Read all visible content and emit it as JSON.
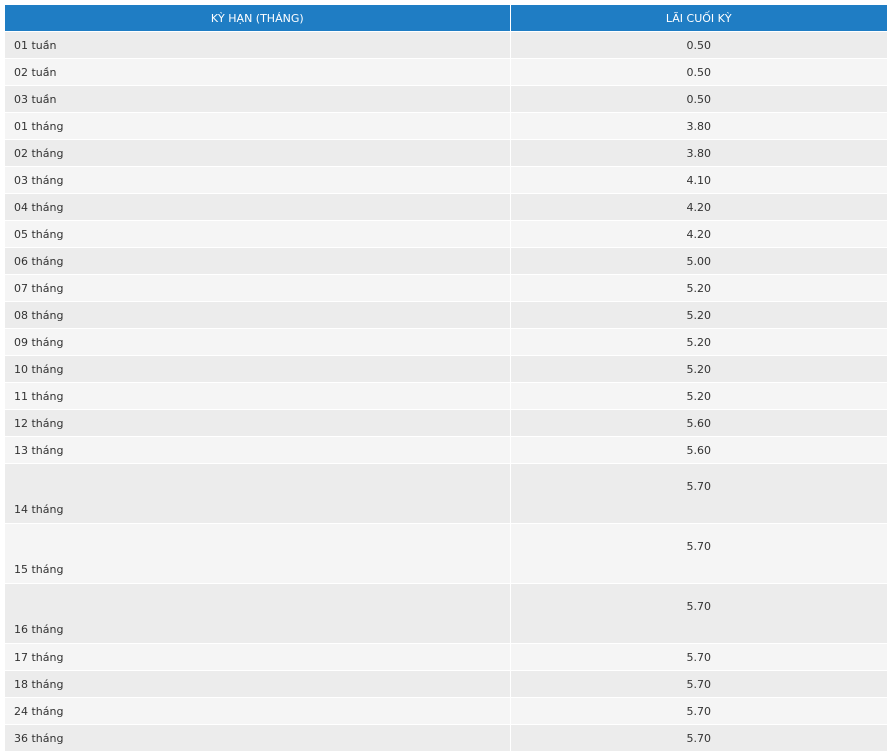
{
  "table": {
    "headers": {
      "term": "KỲ HẠN (THÁNG)",
      "rate": "LÃI CUỐI KỲ"
    },
    "rows": [
      {
        "term": "01 tuần",
        "rate": "0.50"
      },
      {
        "term": "02 tuần",
        "rate": "0.50"
      },
      {
        "term": "03 tuần",
        "rate": "0.50"
      },
      {
        "term": "01 tháng",
        "rate": "3.80"
      },
      {
        "term": "02 tháng",
        "rate": "3.80"
      },
      {
        "term": "03 tháng",
        "rate": "4.10"
      },
      {
        "term": "04 tháng",
        "rate": "4.20"
      },
      {
        "term": "05 tháng",
        "rate": "4.20"
      },
      {
        "term": "06 tháng",
        "rate": "5.00"
      },
      {
        "term": "07 tháng",
        "rate": "5.20"
      },
      {
        "term": "08 tháng",
        "rate": "5.20"
      },
      {
        "term": "09 tháng",
        "rate": "5.20"
      },
      {
        "term": "10 tháng",
        "rate": "5.20"
      },
      {
        "term": "11 tháng",
        "rate": "5.20"
      },
      {
        "term": "12 tháng",
        "rate": "5.60"
      },
      {
        "term": "13 tháng",
        "rate": "5.60"
      },
      {
        "term": "14 tháng",
        "rate": "5.70"
      },
      {
        "term": "15 tháng",
        "rate": "5.70"
      },
      {
        "term": "16 tháng",
        "rate": "5.70"
      },
      {
        "term": "17 tháng",
        "rate": "5.70"
      },
      {
        "term": "18 tháng",
        "rate": "5.70"
      },
      {
        "term": "24 tháng",
        "rate": "5.70"
      },
      {
        "term": "36 tháng",
        "rate": "5.70"
      }
    ]
  },
  "colors": {
    "header_bg": "#1f7dc4",
    "row_odd": "#ececec",
    "row_even": "#f5f5f5"
  }
}
